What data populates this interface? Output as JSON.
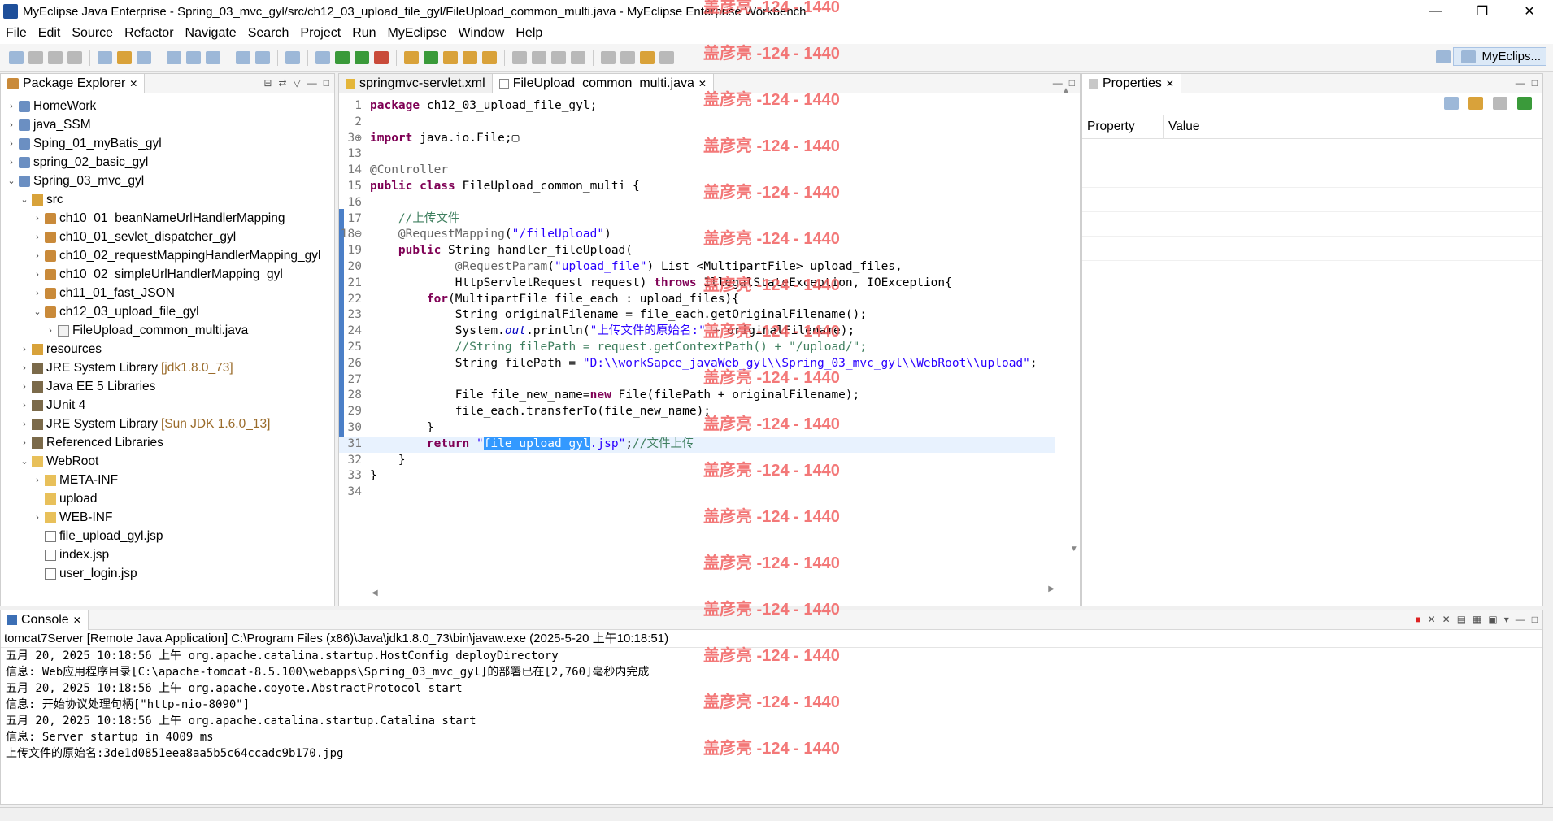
{
  "window": {
    "title": "MyEclipse Java Enterprise - Spring_03_mvc_gyl/src/ch12_03_upload_file_gyl/FileUpload_common_multi.java - MyEclipse Enterprise Workbench",
    "min": "—",
    "max": "❐",
    "close": "✕"
  },
  "menu": [
    "File",
    "Edit",
    "Source",
    "Refactor",
    "Navigate",
    "Search",
    "Project",
    "Run",
    "MyEclipse",
    "Window",
    "Help"
  ],
  "perspective": {
    "label": "MyEclips..."
  },
  "package_explorer": {
    "title": "Package Explorer",
    "items": [
      {
        "label": "HomeWork",
        "depth": 0,
        "arrow": "›",
        "icon": "proj"
      },
      {
        "label": "java_SSM",
        "depth": 0,
        "arrow": "›",
        "icon": "proj"
      },
      {
        "label": "Sping_01_myBatis_gyl",
        "depth": 0,
        "arrow": "›",
        "icon": "proj"
      },
      {
        "label": "spring_02_basic_gyl",
        "depth": 0,
        "arrow": "›",
        "icon": "proj"
      },
      {
        "label": "Spring_03_mvc_gyl",
        "depth": 0,
        "arrow": "⌄",
        "icon": "proj"
      },
      {
        "label": "src",
        "depth": 1,
        "arrow": "⌄",
        "icon": "src"
      },
      {
        "label": "ch10_01_beanNameUrlHandlerMapping",
        "depth": 2,
        "arrow": "›",
        "icon": "pkg"
      },
      {
        "label": "ch10_01_sevlet_dispatcher_gyl",
        "depth": 2,
        "arrow": "›",
        "icon": "pkg"
      },
      {
        "label": "ch10_02_requestMappingHandlerMapping_gyl",
        "depth": 2,
        "arrow": "›",
        "icon": "pkg"
      },
      {
        "label": "ch10_02_simpleUrlHandlerMapping_gyl",
        "depth": 2,
        "arrow": "›",
        "icon": "pkg"
      },
      {
        "label": "ch11_01_fast_JSON",
        "depth": 2,
        "arrow": "›",
        "icon": "pkg"
      },
      {
        "label": "ch12_03_upload_file_gyl",
        "depth": 2,
        "arrow": "⌄",
        "icon": "pkg"
      },
      {
        "label": "FileUpload_common_multi.java",
        "depth": 3,
        "arrow": "›",
        "icon": "java"
      },
      {
        "label": "resources",
        "depth": 1,
        "arrow": "›",
        "icon": "src"
      },
      {
        "label": "JRE System Library",
        "deco": "[jdk1.8.0_73]",
        "depth": 1,
        "arrow": "›",
        "icon": "lib"
      },
      {
        "label": "Java EE 5 Libraries",
        "depth": 1,
        "arrow": "›",
        "icon": "lib"
      },
      {
        "label": "JUnit 4",
        "depth": 1,
        "arrow": "›",
        "icon": "lib"
      },
      {
        "label": "JRE System Library",
        "deco": "[Sun JDK 1.6.0_13]",
        "depth": 1,
        "arrow": "›",
        "icon": "lib"
      },
      {
        "label": "Referenced Libraries",
        "depth": 1,
        "arrow": "›",
        "icon": "lib"
      },
      {
        "label": "WebRoot",
        "depth": 1,
        "arrow": "⌄",
        "icon": "folder"
      },
      {
        "label": "META-INF",
        "depth": 2,
        "arrow": "›",
        "icon": "folder"
      },
      {
        "label": "upload",
        "depth": 2,
        "arrow": "",
        "icon": "folder"
      },
      {
        "label": "WEB-INF",
        "depth": 2,
        "arrow": "›",
        "icon": "folder"
      },
      {
        "label": "file_upload_gyl.jsp",
        "depth": 2,
        "arrow": "",
        "icon": "file"
      },
      {
        "label": "index.jsp",
        "depth": 2,
        "arrow": "",
        "icon": "file"
      },
      {
        "label": "user_login.jsp",
        "depth": 2,
        "arrow": "",
        "icon": "file"
      }
    ]
  },
  "editor": {
    "tabs": [
      {
        "label": "springmvc-servlet.xml",
        "active": false
      },
      {
        "label": "FileUpload_common_multi.java",
        "active": true
      }
    ],
    "lines": [
      {
        "n": "1",
        "html": "<span class='kw'>package</span> ch12_03_upload_file_gyl;"
      },
      {
        "n": "2",
        "html": ""
      },
      {
        "n": "3⊕",
        "html": "<span class='kw'>import</span> java.io.File;▢"
      },
      {
        "n": "13",
        "html": ""
      },
      {
        "n": "14",
        "html": "<span class='an'>@Controller</span>"
      },
      {
        "n": "15",
        "html": "<span class='kw'>public class</span> FileUpload_common_multi {"
      },
      {
        "n": "16",
        "html": ""
      },
      {
        "n": "17",
        "html": "    <span class='cm'>//上传文件</span>"
      },
      {
        "n": "18⊖",
        "html": "    <span class='an'>@RequestMapping</span>(<span class='st'>\"/fileUpload\"</span>)"
      },
      {
        "n": "19",
        "html": "    <span class='kw'>public</span> String handler_fileUpload("
      },
      {
        "n": "20",
        "html": "            <span class='an'>@RequestParam</span>(<span class='st'>\"upload_file\"</span>) List &lt;MultipartFile&gt; upload_files,"
      },
      {
        "n": "21",
        "html": "            HttpServletRequest request) <span class='kw'>throws</span> IllegalStateException, IOException{"
      },
      {
        "n": "22",
        "html": "        <span class='kw'>for</span>(MultipartFile file_each : upload_files){"
      },
      {
        "n": "23",
        "html": "            String originalFilename = file_each.getOriginalFilename();"
      },
      {
        "n": "24",
        "html": "            System.<span class='it'>out</span>.println(<span class='st'>\"上传文件的原始名:\"</span> + originalFilename);"
      },
      {
        "n": "25",
        "html": "            <span class='cm'>//String filePath = request.getContextPath() + \"/upload/\";</span>"
      },
      {
        "n": "26",
        "html": "            String filePath = <span class='st'>\"D:\\\\workSapce_javaWeb_gyl\\\\Spring_03_mvc_gyl\\\\WebRoot\\\\upload\"</span>;"
      },
      {
        "n": "27",
        "html": ""
      },
      {
        "n": "28",
        "html": "            File file_new_name=<span class='kw'>new</span> File(filePath + originalFilename);"
      },
      {
        "n": "29",
        "html": "            file_each.transferTo(file_new_name);"
      },
      {
        "n": "30",
        "html": "        }"
      },
      {
        "n": "31",
        "html": "        <span class='kw'>return</span> <span class='st'>\"<span class='sel'>file_upload_gyl</span>.jsp\"</span>;<span class='cm'>//文件上传</span>",
        "current": true
      },
      {
        "n": "32",
        "html": "    }"
      },
      {
        "n": "33",
        "html": "}"
      },
      {
        "n": "34",
        "html": ""
      }
    ]
  },
  "properties": {
    "title": "Properties",
    "col_property": "Property",
    "col_value": "Value"
  },
  "console": {
    "title": "Console",
    "info": "tomcat7Server [Remote Java Application] C:\\Program Files (x86)\\Java\\jdk1.8.0_73\\bin\\javaw.exe (2025-5-20 上午10:18:51)",
    "lines": [
      "五月 20, 2025 10:18:56 上午 org.apache.catalina.startup.HostConfig deployDirectory",
      "信息: Web应用程序目录[C:\\apache-tomcat-8.5.100\\webapps\\Spring_03_mvc_gyl]的部署已在[2,760]毫秒内完成",
      "五月 20, 2025 10:18:56 上午 org.apache.coyote.AbstractProtocol start",
      "信息: 开始协议处理句柄[\"http-nio-8090\"]",
      "五月 20, 2025 10:18:56 上午 org.apache.catalina.startup.Catalina start",
      "信息: Server startup in 4009 ms",
      "上传文件的原始名:3de1d0851eea8aa5b5c64ccadc9b170.jpg"
    ]
  },
  "watermark": {
    "text": "盖彦亮 -124 - 1440",
    "count": 17
  }
}
